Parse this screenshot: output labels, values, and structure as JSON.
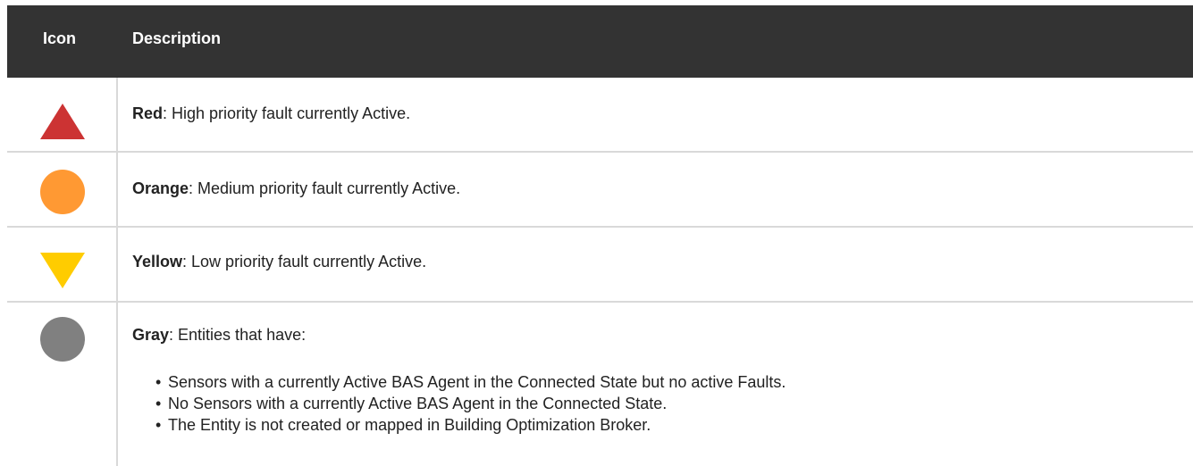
{
  "table": {
    "headers": {
      "icon": "Icon",
      "description": "Description"
    },
    "rows": [
      {
        "icon": "red-triangle-up-icon",
        "color": "#cc3333",
        "label": "Red",
        "text": ": High priority fault currently Active."
      },
      {
        "icon": "orange-circle-icon",
        "color": "#ff9933",
        "label": "Orange",
        "text": ": Medium priority fault currently Active."
      },
      {
        "icon": "yellow-triangle-down-icon",
        "color": "#ffcc00",
        "label": "Yellow",
        "text": ": Low priority fault currently Active."
      },
      {
        "icon": "gray-circle-icon",
        "color": "#808080",
        "label": "Gray",
        "text": ": Entities that have:",
        "bullets": [
          "Sensors with a currently Active BAS Agent in the Connected State but no active Faults.",
          "No Sensors with a currently Active BAS Agent in the Connected State.",
          "The Entity is not created or mapped in Building Optimization Broker."
        ]
      }
    ]
  }
}
